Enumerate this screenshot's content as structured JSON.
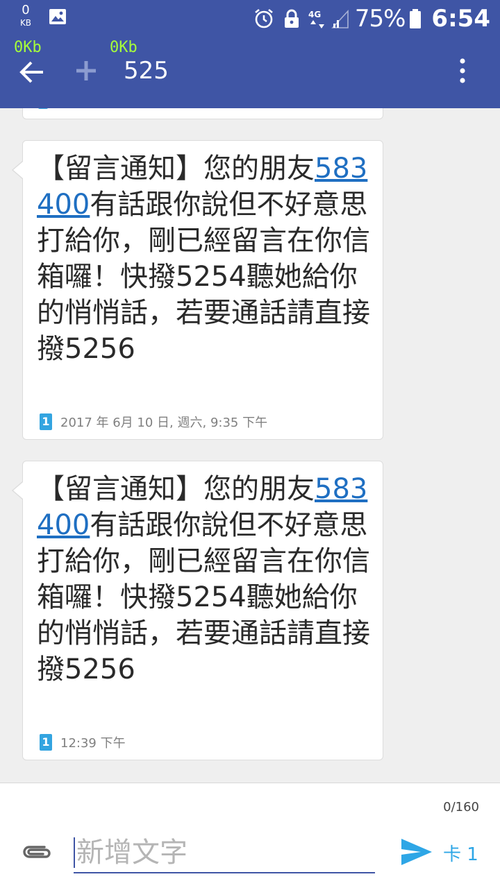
{
  "status_bar": {
    "data_rate_value": "0",
    "data_rate_unit": "KB",
    "network": "4G",
    "battery": "75%",
    "time": "6:54"
  },
  "speed_meters": {
    "left": "0Kb",
    "right": "0Kb"
  },
  "header": {
    "title": "525"
  },
  "messages": [
    {
      "prefix": "【留言通知】您的朋友",
      "number": "583400",
      "body": "有話跟你說但不好意思打給你，剛已經留言在你信箱囉！快撥5254聽她給你的悄悄話，若要通話請直接撥5256",
      "sim": "1",
      "timestamp": "2017 年 6月 10 日, 週六, 9:35 下午"
    },
    {
      "prefix": "【留言通知】您的朋友",
      "number": "583400",
      "body": "有話跟你說但不好意思打給你，剛已經留言在你信箱囉！快撥5254聽她給你的悄悄話，若要通話請直接撥5256",
      "sim": "1",
      "timestamp": "12:39 下午"
    }
  ],
  "compose": {
    "counter": "0/160",
    "placeholder": "新增文字",
    "sim_label": "卡 1"
  },
  "colors": {
    "app_bar": "#3f55a5",
    "speed_text": "#a6ff3a",
    "link": "#1f6fc2",
    "sim_badge": "#33a4e0",
    "send": "#2ea6e6"
  }
}
